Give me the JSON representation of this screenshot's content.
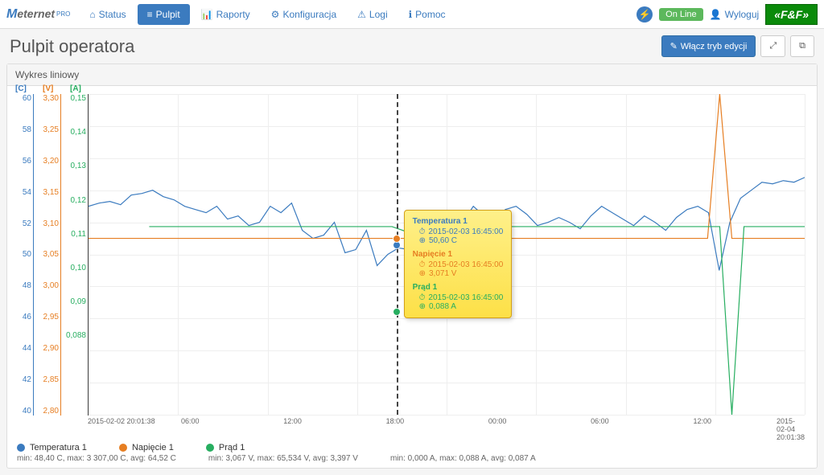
{
  "app": {
    "logo_m": "M",
    "logo_e": "eternet",
    "logo_pro": "PRO"
  },
  "nav": {
    "items": [
      {
        "label": "Status",
        "icon": "⌂"
      },
      {
        "label": "Pulpit",
        "icon": "≡"
      },
      {
        "label": "Raporty",
        "icon": "📊"
      },
      {
        "label": "Konfiguracja",
        "icon": "⚙"
      },
      {
        "label": "Logi",
        "icon": "⚠"
      },
      {
        "label": "Pomoc",
        "icon": "ℹ"
      }
    ],
    "status": "On Line",
    "logout": "Wyloguj",
    "brand": "«F&F»"
  },
  "header": {
    "title": "Pulpit operatora",
    "edit_btn": "Włącz tryb edycji",
    "expand_icon": "⤢",
    "popout_icon": "⧉"
  },
  "panel": {
    "title": "Wykres liniowy"
  },
  "axes": {
    "y1": {
      "label": "[C]",
      "ticks": [
        "60",
        "58",
        "56",
        "54",
        "52",
        "50",
        "48",
        "46",
        "44",
        "42",
        "40"
      ]
    },
    "y2": {
      "label": "[V]",
      "ticks": [
        "3,30",
        "3,25",
        "3,20",
        "3,15",
        "3,10",
        "3,05",
        "3,00",
        "2,95",
        "2,90",
        "2,85",
        "2,80"
      ]
    },
    "y3": {
      "label": "[A]",
      "ticks": [
        "0,15",
        "0,14",
        "0,13",
        "0,12",
        "0,11",
        "0,10",
        "0,09",
        "0,088",
        "",
        "",
        ""
      ]
    },
    "x": {
      "ticks": [
        "2015-02-02 20:01:38",
        "06:00",
        "12:00",
        "18:00",
        "00:00",
        "06:00",
        "12:00",
        "2015-02-04 20:01:38"
      ],
      "extra": ")"
    }
  },
  "tooltip": {
    "sections": [
      {
        "title": "Temperatura 1",
        "color": "#3b7bbf",
        "time": "2015-02-03 16:45:00",
        "value": "50,60 C"
      },
      {
        "title": "Napięcie 1",
        "color": "#e67e22",
        "time": "2015-02-03 16:45:00",
        "value": "3,071 V"
      },
      {
        "title": "Prąd 1",
        "color": "#27ae60",
        "time": "2015-02-03 16:45:00",
        "value": "0,088 A"
      }
    ],
    "clock_icon": "⏱",
    "target_icon": "⊕"
  },
  "legend": {
    "items": [
      {
        "label": "Temperatura 1",
        "color": "#3b7bbf",
        "stats": "min: 48,40 C, max: 3 307,00 C, avg: 64,52 C"
      },
      {
        "label": "Napięcie 1",
        "color": "#e67e22",
        "stats": "min: 3,067 V, max: 65,534 V, avg: 3,397 V"
      },
      {
        "label": "Prąd 1",
        "color": "#27ae60",
        "stats": "min: 0,000 A, max: 0,088 A, avg: 0,087 A"
      }
    ]
  },
  "chart_data": {
    "type": "line",
    "title": "Wykres liniowy",
    "x_range": [
      "2015-02-02 20:01:38",
      "2015-02-04 20:01:38"
    ],
    "x_ticks": [
      "2015-02-02 20:01:38",
      "06:00",
      "12:00",
      "18:00",
      "00:00",
      "06:00",
      "12:00",
      "2015-02-04 20:01:38"
    ],
    "series": [
      {
        "name": "Temperatura 1",
        "unit": "C",
        "y_range": [
          40,
          60
        ],
        "color": "#3b7bbf",
        "approx_values": [
          53.0,
          53.2,
          53.3,
          53.1,
          53.7,
          53.8,
          54.0,
          53.6,
          53.4,
          53.0,
          52.8,
          52.6,
          53.0,
          52.2,
          52.4,
          51.8,
          52.0,
          53.0,
          52.6,
          53.2,
          51.5,
          51.0,
          51.2,
          52.0,
          50.1,
          50.3,
          51.5,
          49.3,
          50.0,
          50.4,
          50.3,
          50.6,
          50.6,
          50.9,
          52.5,
          52.0,
          53.0,
          52.4,
          52.2,
          52.8,
          53.0,
          52.5,
          51.8,
          52.0,
          52.3,
          52.0,
          51.6,
          52.4,
          53.0,
          52.6,
          52.2,
          51.8,
          52.4,
          52.0,
          51.5,
          52.3,
          52.8,
          53.0,
          52.6,
          49.0,
          52.0,
          53.5,
          54.0,
          54.5,
          54.4,
          54.6,
          54.5,
          54.8
        ]
      },
      {
        "name": "Napięcie 1",
        "unit": "V",
        "y_range": [
          2.8,
          3.3
        ],
        "color": "#e67e22",
        "approx_values": [
          3.075,
          3.075,
          3.075,
          3.075,
          3.075,
          3.075,
          3.075,
          3.075,
          3.075,
          3.075,
          3.075,
          3.075,
          3.075,
          3.075,
          3.075,
          3.075,
          3.075,
          3.075,
          3.075,
          3.075,
          3.075,
          3.075,
          3.075,
          3.075,
          3.075,
          3.075,
          3.075,
          3.075,
          3.071,
          3.071,
          3.071,
          3.075,
          3.075,
          3.075,
          3.075,
          3.075,
          3.075,
          3.075,
          3.075,
          3.075,
          3.075,
          3.075,
          3.075,
          3.075,
          3.075,
          3.075,
          3.075,
          3.075,
          3.075,
          3.075,
          3.075,
          3.075,
          3.3,
          3.075,
          3.075,
          3.075,
          3.075,
          3.075,
          3.075,
          3.075
        ]
      },
      {
        "name": "Prąd 1",
        "unit": "A",
        "y_range": [
          0.0,
          0.15
        ],
        "color": "#27ae60",
        "approx_values": [
          null,
          null,
          null,
          null,
          null,
          0.088,
          0.088,
          0.088,
          0.088,
          0.088,
          0.088,
          0.088,
          0.088,
          0.088,
          0.088,
          0.088,
          0.088,
          0.088,
          0.088,
          0.088,
          0.088,
          0.088,
          0.088,
          0.088,
          0.088,
          0.088,
          0.086,
          0.088,
          0.088,
          0.088,
          0.088,
          0.088,
          0.088,
          0.088,
          0.088,
          0.088,
          0.088,
          0.088,
          0.088,
          0.088,
          0.088,
          0.088,
          0.088,
          0.088,
          0.088,
          0.088,
          0.088,
          0.088,
          0.088,
          0.088,
          0.088,
          0.088,
          0.088,
          0.0,
          0.088,
          0.088,
          0.088,
          0.088,
          0.088,
          0.088
        ]
      }
    ],
    "cursor_time": "2015-02-03 16:45:00"
  }
}
